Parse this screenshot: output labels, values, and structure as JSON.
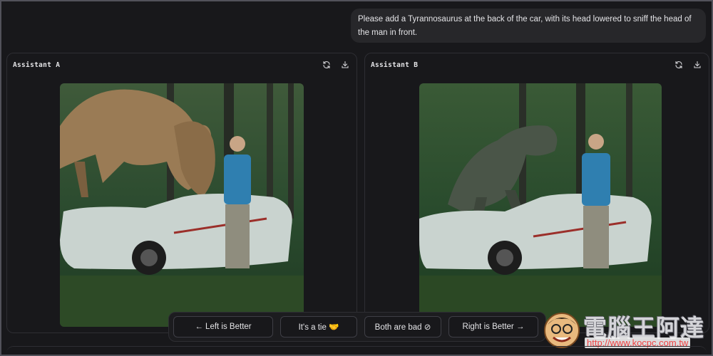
{
  "prompt": {
    "text": "Please add a Tyrannosaurus at the back of the car, with its head lowered to sniff the head of the man in front."
  },
  "panels": [
    {
      "title": "Assistant A",
      "actions": [
        "refresh-icon",
        "download-icon"
      ],
      "image_alt": "T-rex behind an overgrown white car sniffing the man's head in a forest"
    },
    {
      "title": "Assistant B",
      "actions": [
        "refresh-icon",
        "download-icon"
      ],
      "image_alt": "Dark green T-rex standing on the back of an overgrown white car in a forest"
    }
  ],
  "vote": {
    "left": "← Left is Better",
    "tie": "It's a tie 🤝",
    "bad": "Both are bad ⊘",
    "right": "Right is Better →"
  },
  "watermark": {
    "title": "電腦王阿達",
    "url": "http://www.kocpc.com.tw"
  },
  "colors": {
    "background": "#18181b",
    "panel_border": "#2e2e33",
    "bubble": "#27272a",
    "watermark_url": "#ef4444"
  }
}
